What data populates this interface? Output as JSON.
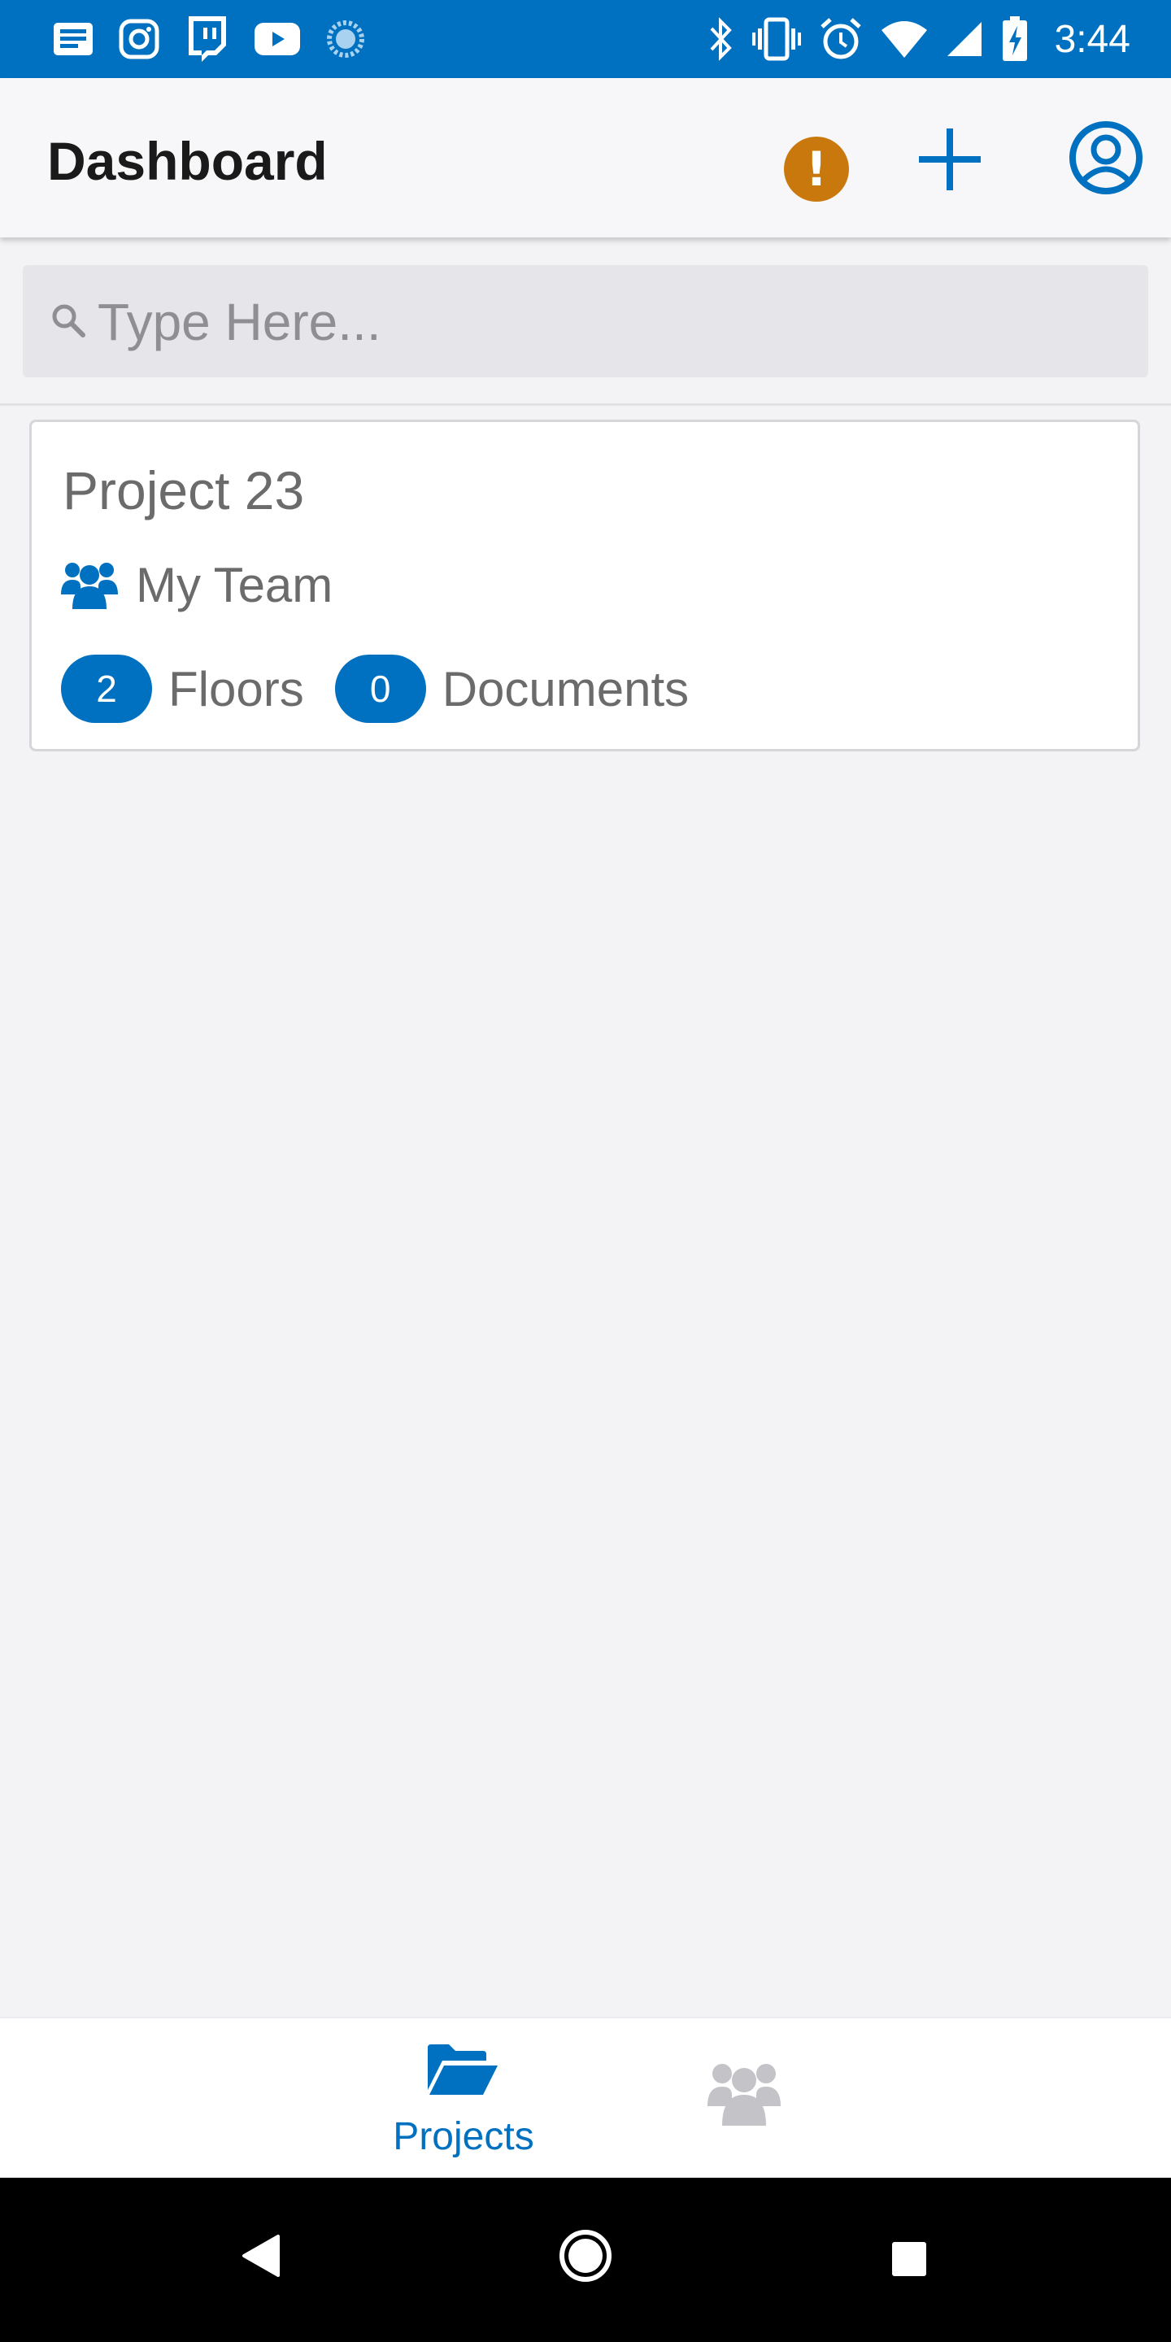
{
  "status_bar": {
    "time": "3:44",
    "left_icons": [
      "news-icon",
      "instagram-icon",
      "twitch-icon",
      "youtube-icon",
      "loading-icon"
    ],
    "right_icons": [
      "bluetooth-icon",
      "vibrate-icon",
      "alarm-icon",
      "wifi-icon",
      "signal-icon",
      "battery-charging-icon"
    ],
    "background_color": "#0070c0"
  },
  "app_bar": {
    "title": "Dashboard",
    "alert_icon": "alert-icon",
    "alert_color": "#c8780c",
    "add_icon": "plus-icon",
    "profile_icon": "user-circle-icon"
  },
  "search": {
    "placeholder": "Type Here...",
    "value": ""
  },
  "projects": [
    {
      "name": "Project 23",
      "team": "My Team",
      "floors_count": "2",
      "floors_label": "Floors",
      "documents_count": "0",
      "documents_label": "Documents"
    }
  ],
  "tab_bar": {
    "tabs": [
      {
        "label": "Projects",
        "icon": "folder-open-icon",
        "active": true
      },
      {
        "label": "",
        "icon": "team-icon",
        "active": false
      }
    ],
    "active_color": "#0070c0",
    "inactive_color": "#c4c4c8"
  },
  "nav_bar": {
    "buttons": [
      "back-icon",
      "home-icon",
      "recents-icon"
    ]
  }
}
